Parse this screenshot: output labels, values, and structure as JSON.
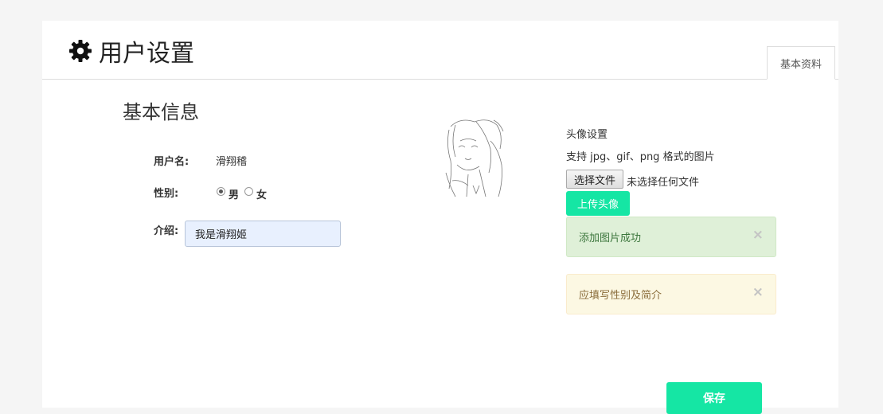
{
  "header": {
    "title": "用户设置",
    "icon": "gear-icon"
  },
  "tabs": [
    {
      "label": "基本资料",
      "active": true
    }
  ],
  "basic_info": {
    "section_title": "基本信息",
    "username_label": "用户名:",
    "username_value": "滑翔稽",
    "gender_label": "性别:",
    "gender_options": [
      "男",
      "女"
    ],
    "gender_selected": "男",
    "intro_label": "介绍:",
    "intro_value": "我是滑翔姬"
  },
  "avatar_settings": {
    "title": "头像设置",
    "hint": "支持 jpg、gif、png 格式的图片",
    "choose_file_label": "选择文件",
    "no_file_text": "未选择任何文件",
    "upload_label": "上传头像"
  },
  "alerts": [
    {
      "type": "success",
      "text": "添加图片成功",
      "close": "×"
    },
    {
      "type": "warning",
      "text": "应填写性别及简介",
      "close": "×"
    }
  ],
  "save_label": "保存",
  "colors": {
    "accent": "#15e6a4",
    "success_bg": "#dff0d8",
    "warning_bg": "#fcf8e3"
  }
}
